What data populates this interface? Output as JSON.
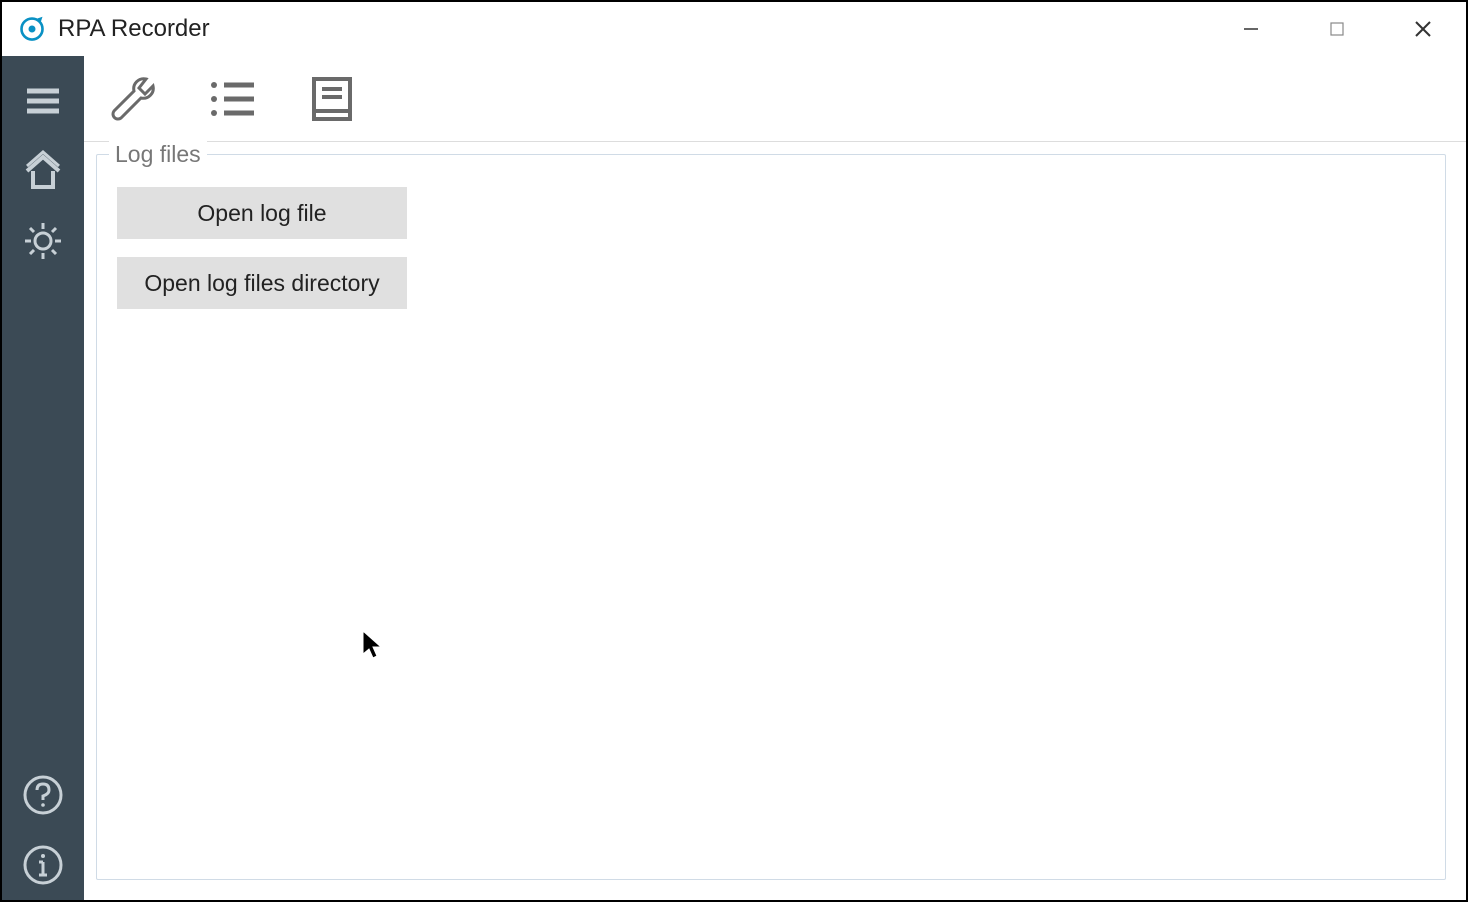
{
  "titlebar": {
    "title": "RPA Recorder"
  },
  "panel": {
    "label": "Log files",
    "buttons": {
      "open_log_file": "Open log file",
      "open_dir": "Open log files directory"
    }
  }
}
